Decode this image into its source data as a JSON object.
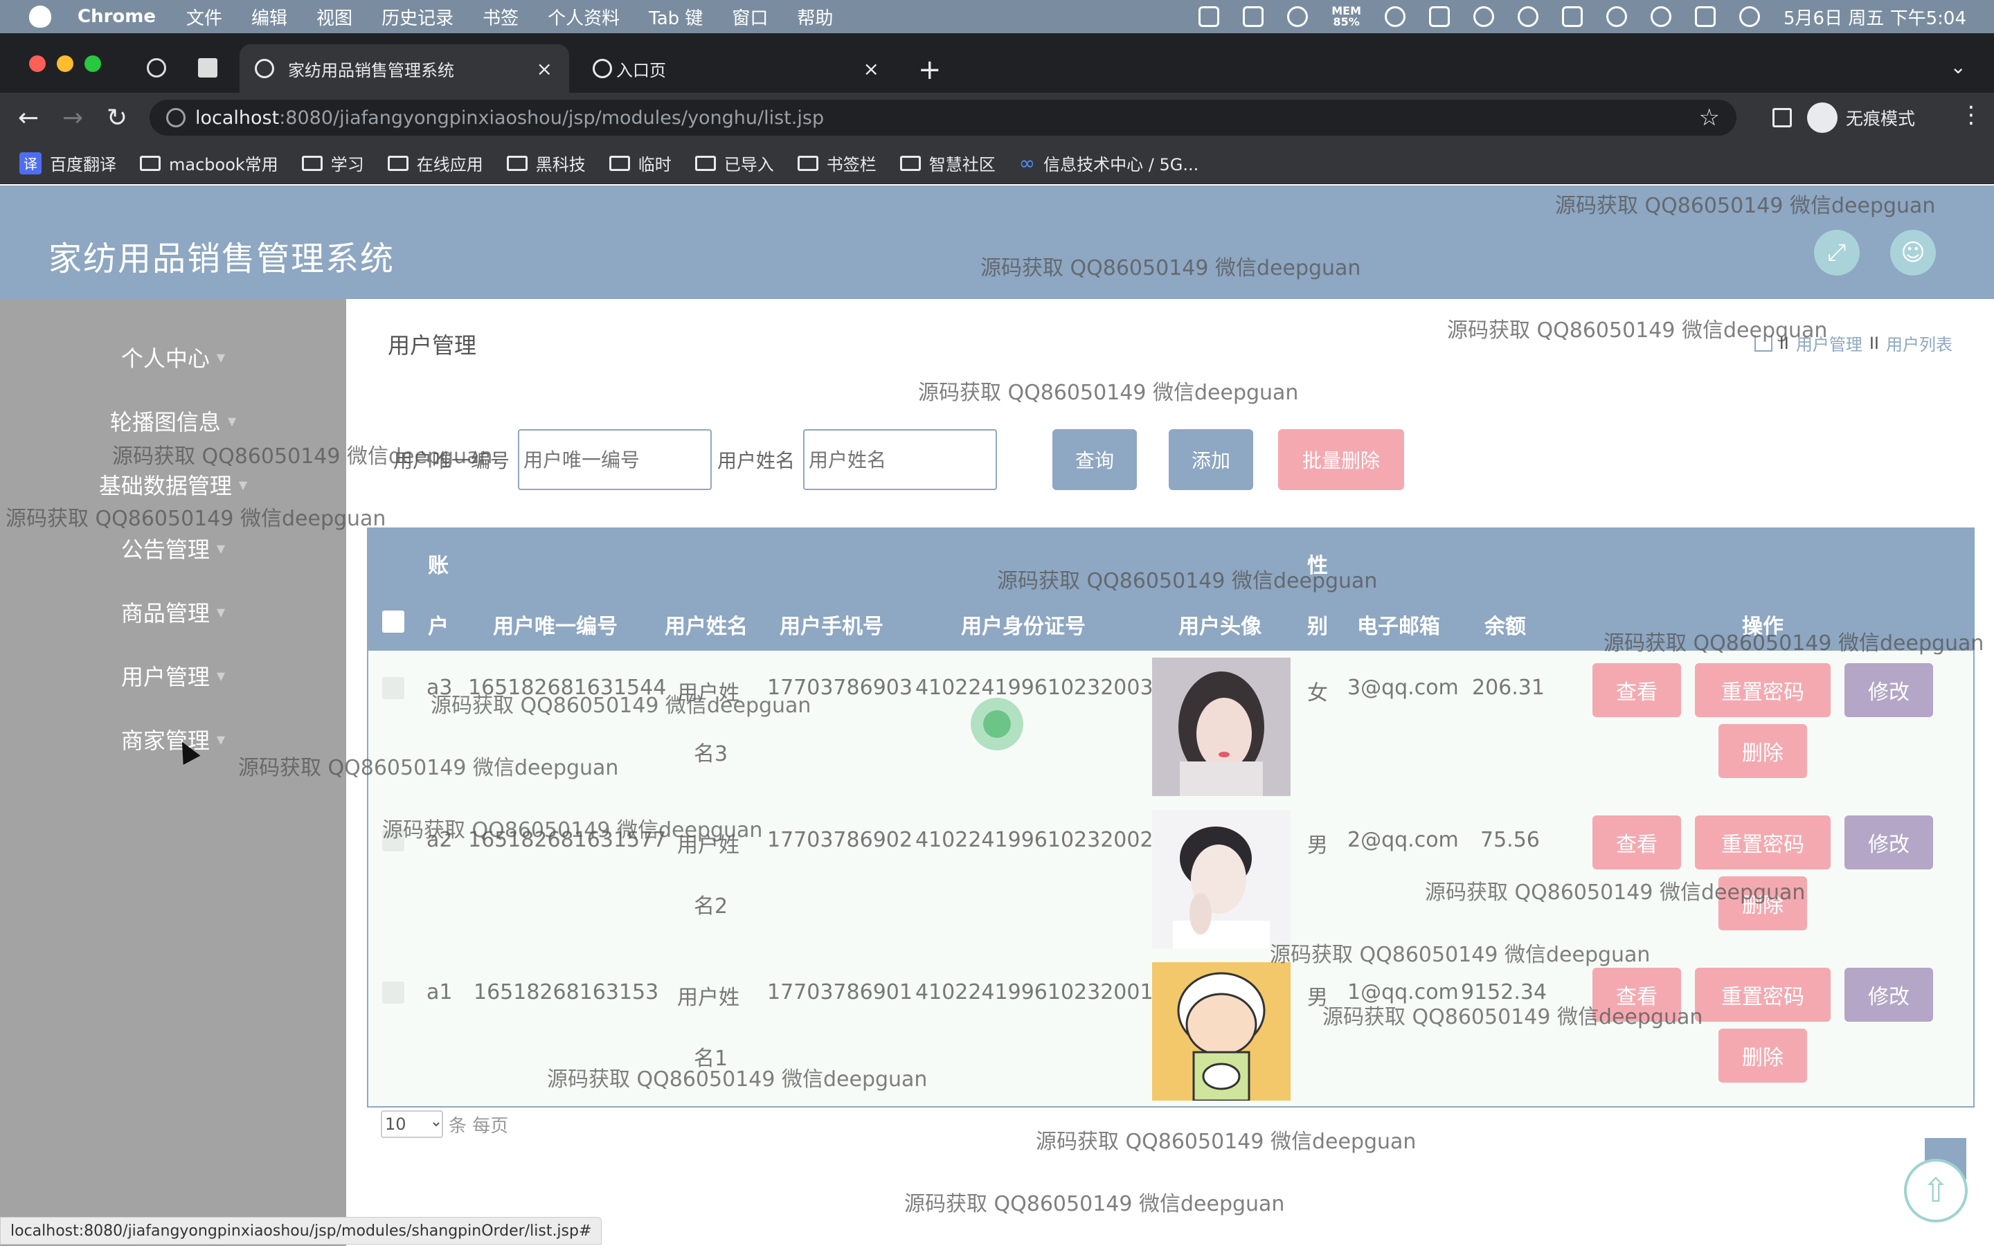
{
  "menubar": {
    "app_name": "Chrome",
    "items": [
      "文件",
      "编辑",
      "视图",
      "历史记录",
      "书签",
      "个人资料",
      "Tab 键",
      "窗口",
      "帮助"
    ],
    "mem": "MEM\n85%",
    "clock": "5月6日 周五 下午5:04"
  },
  "browser": {
    "tabs": [
      {
        "title": "家纺用品销售管理系统",
        "active": true
      },
      {
        "title": "入口页",
        "active": false
      }
    ],
    "url_host": "localhost",
    "url_path": ":8080/jiafangyongpinxiaoshou/jsp/modules/yonghu/list.jsp",
    "incognito_label": "无痕模式",
    "bookmarks": [
      "百度翻译",
      "macbook常用",
      "学习",
      "在线应用",
      "黑科技",
      "临时",
      "已导入",
      "书签栏",
      "智慧社区",
      "信息技术中心 / 5G..."
    ],
    "status_url": "localhost:8080/jiafangyongpinxiaoshou/jsp/modules/shangpinOrder/list.jsp#"
  },
  "app": {
    "title": "家纺用品销售管理系统",
    "sidebar": [
      "个人中心",
      "轮播图信息",
      "基础数据管理",
      "公告管理",
      "商品管理",
      "用户管理",
      "商家管理"
    ],
    "page_title": "用户管理",
    "breadcrumb": {
      "sep": "II",
      "items": [
        "用户管理",
        "用户列表"
      ]
    },
    "search": {
      "field1_label": "用户唯一编号",
      "field1_placeholder": "用户唯一编号",
      "field2_label": "用户姓名",
      "field2_placeholder": "用户姓名",
      "query_btn": "查询",
      "add_btn": "添加",
      "batch_delete_btn": "批量删除"
    },
    "table": {
      "headers": {
        "account_top": "账",
        "account_bottom": "户",
        "uid": "用户唯一编号",
        "name": "用户姓名",
        "phone": "用户手机号",
        "idcard": "用户身份证号",
        "avatar": "用户头像",
        "gender_top": "性",
        "gender_bottom": "别",
        "email": "电子邮箱",
        "balance": "余额",
        "ops": "操作"
      },
      "rows": [
        {
          "account": "a3",
          "uid": "165182681631544",
          "name1": "用户姓",
          "name2": "名3",
          "phone": "17703786903",
          "idcard": "410224199610232003",
          "gender": "女",
          "email": "3@qq.com",
          "balance": "206.31"
        },
        {
          "account": "a2",
          "uid": "165182681631577",
          "name1": "用户姓",
          "name2": "名2",
          "phone": "17703786902",
          "idcard": "410224199610232002",
          "gender": "男",
          "email": "2@qq.com",
          "balance": "75.56"
        },
        {
          "account": "a1",
          "uid": "16518268163153",
          "name1": "用户姓",
          "name2": "名1",
          "phone": "17703786901",
          "idcard": "410224199610232001",
          "gender": "男",
          "email": "1@qq.com",
          "balance": "9152.34"
        }
      ],
      "actions": {
        "view": "查看",
        "reset": "重置密码",
        "edit": "修改",
        "delete": "删除"
      }
    },
    "pager": {
      "page_size": "10",
      "suffix": "条 每页"
    }
  },
  "watermark_text": "源码获取 QQ86050149 微信deepguan",
  "colors": {
    "header": "#8ea7c2",
    "sidebar": "#a3a3a3",
    "pink_button": "#f4a9b0",
    "purple_button": "#b4a6c6"
  }
}
